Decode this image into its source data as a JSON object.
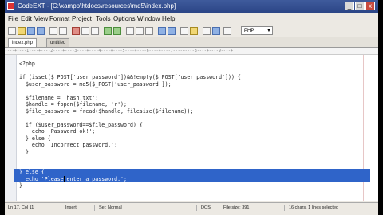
{
  "window": {
    "title": "CodeEXT - [C:\\xampp\\htdocs\\resources\\md5\\index.php]",
    "minimize": "_",
    "maximize": "□",
    "close": "x"
  },
  "menu": [
    "File",
    "Edit",
    "View",
    "Format",
    "Project",
    "Tools",
    "Options",
    "Window",
    "Help"
  ],
  "language_select": "PHP",
  "tabs": [
    "index.php",
    "untitled"
  ],
  "ruler": "----+----1----+----2----+----3----+----4----+----5----+----6----+----7----+----8----+----9----+",
  "code": [
    "<?php",
    "",
    "if (isset($_POST['user_password'])&&!empty($_POST['user_password'])) {",
    "  $user_password = md5($_POST['user_password']);",
    "",
    "  $filename = 'hash.txt';",
    "  $handle = fopen($filename, 'r');",
    "  $file_password = fread($handle, filesize($filename));",
    "",
    "  if ($user_password==$file_password) {",
    "    echo 'Password ok!';",
    "  } else {",
    "    echo 'Incorrect password.';",
    "  }",
    "",
    "",
    "} else {",
    "  echo 'Please enter a password.';",
    "}"
  ],
  "status": {
    "position": "Ln 17, Col 11",
    "mode": "Insert",
    "selection": "Sel: Normal",
    "encoding": "DOS",
    "file_size": "File size: 391",
    "selected": "16 chars, 1 lines selected"
  }
}
